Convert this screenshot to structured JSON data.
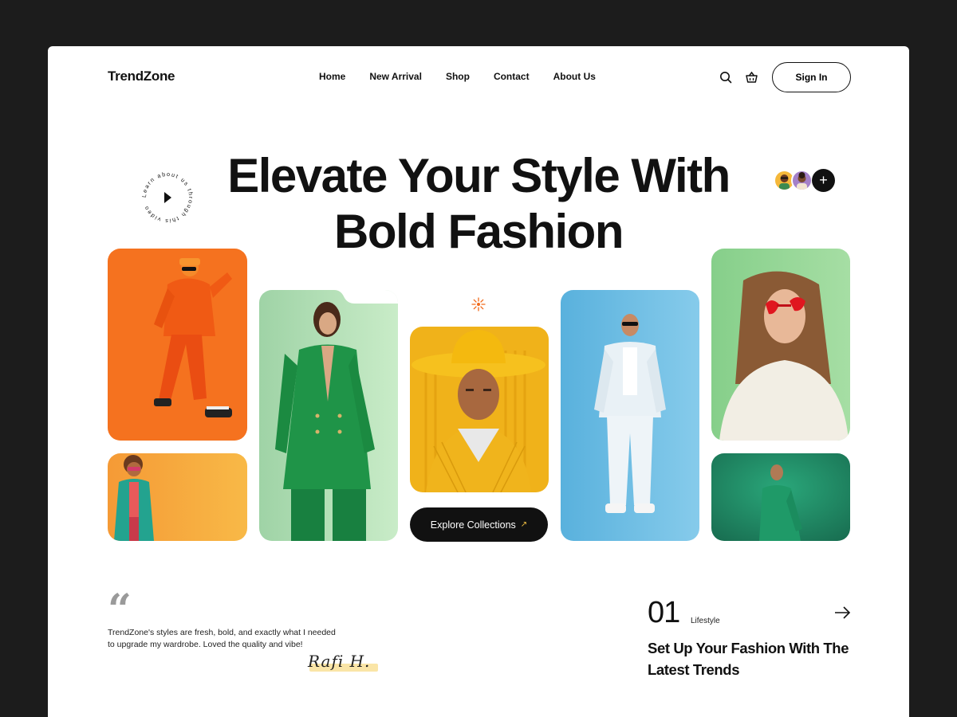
{
  "brand": {
    "name": "TrendZone"
  },
  "nav": {
    "items": [
      {
        "label": "Home"
      },
      {
        "label": "New Arrival"
      },
      {
        "label": "Shop"
      },
      {
        "label": "Contact"
      },
      {
        "label": "About Us"
      }
    ],
    "search_icon": "search-icon",
    "cart_icon": "basket-icon",
    "signin_label": "Sign In"
  },
  "hero": {
    "title_line1": "Elevate Your Style With",
    "title_line2": "Bold Fashion",
    "video_badge_text": "Learn about us through this video",
    "avatars_more": "+",
    "cta_label": "Explore Collections",
    "cta_arrow": "↗"
  },
  "gallery": {
    "cards": [
      {
        "name": "orange-outfit-dancer",
        "bg": "#f26a1b"
      },
      {
        "name": "colorful-suit-man",
        "bg": "#f6a83a"
      },
      {
        "name": "green-coat-woman",
        "bg": "#bde3c0"
      },
      {
        "name": "yellow-hat-man",
        "bg": "#f2b417"
      },
      {
        "name": "white-outfit-man",
        "bg": "#5fb4df"
      },
      {
        "name": "heart-glasses-woman",
        "bg": "#8fd18f"
      },
      {
        "name": "green-suit-man",
        "bg": "#1f8a62"
      }
    ]
  },
  "testimonial": {
    "quote_mark": "“",
    "text": "TrendZone's styles are fresh, bold, and exactly what I needed to upgrade my wardrobe. Loved the quality and vibe!",
    "signature": "Rafi H."
  },
  "feature": {
    "number": "01",
    "category": "Lifestyle",
    "title": "Set Up Your Fashion With The Latest Trends",
    "arrow_icon": "arrow-right-icon"
  }
}
